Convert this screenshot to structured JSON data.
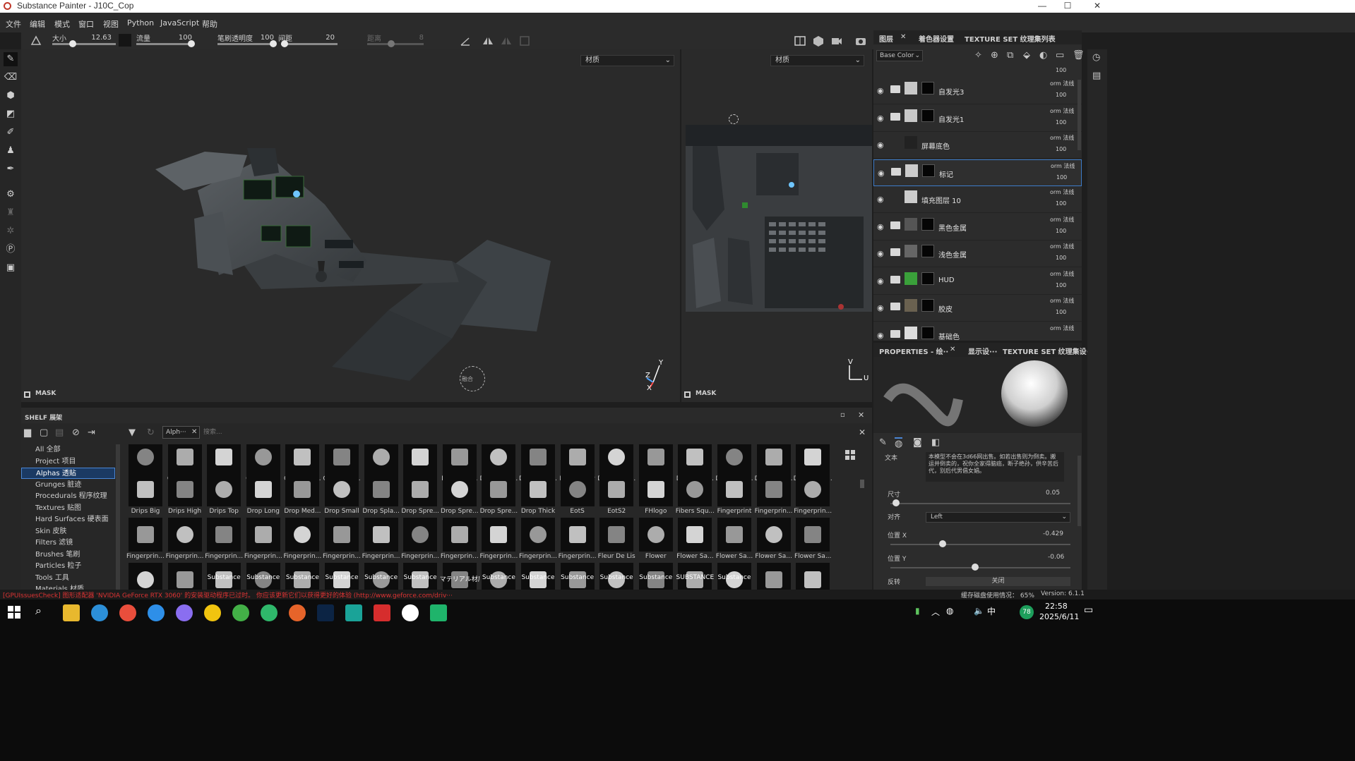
{
  "window": {
    "title": "Substance Painter - J10C_Cop",
    "min": "—",
    "max": "☐",
    "close": "✕"
  },
  "menu": [
    "文件",
    "编辑",
    "模式",
    "窗口",
    "视图",
    "Python",
    "JavaScript",
    "帮助"
  ],
  "tool_options": {
    "size_label": "大小",
    "size_value": "12.63",
    "flow_label": "流量",
    "flow_value": "100",
    "opacity_label": "笔刷透明度",
    "opacity_value": "100",
    "spacing_label": "间距",
    "spacing_value": "20",
    "angle_label": "距离",
    "angle_value": "8"
  },
  "viewport3d": {
    "material_select": "材质",
    "mask_label": "MASK",
    "axis_y": "Y",
    "axis_z": "Z",
    "axis_x": "X",
    "cursor_hint": "融合"
  },
  "viewport2d": {
    "material_select": "材质",
    "mask_label": "MASK",
    "axis_v": "V",
    "axis_u": "U"
  },
  "shelf": {
    "title": "SHELF 展架",
    "filter_chip": "Alph···",
    "search_placeholder": "搜索...",
    "categories": [
      {
        "label": "All 全部"
      },
      {
        "label": "Project 项目"
      },
      {
        "label": "Alphas 透贴"
      },
      {
        "label": "Grunges 脏迹"
      },
      {
        "label": "Procedurals 程序纹理"
      },
      {
        "label": "Textures 贴图"
      },
      {
        "label": "Hard Surfaces 硬表面"
      },
      {
        "label": "Skin 皮肤"
      },
      {
        "label": "Filters 滤镜"
      },
      {
        "label": "Brushes 笔刷"
      },
      {
        "label": "Particles 粒子"
      },
      {
        "label": "Tools 工具"
      },
      {
        "label": "Materials 材质"
      }
    ],
    "row1": [
      "Cross Half",
      "Cross Me...",
      "Cross Me...",
      "Cross Me...",
      "Cross Rec...",
      "Cross Rou...",
      "Cross Split",
      "Cross Thin",
      "Diagonal ...",
      "Dirt Blurry...",
      "Dirt Brush...",
      "Dirt Cloudy",
      "Dirt Smud...",
      "Dirt Spots",
      "Dirt Spots...",
      "Dirt Spots...",
      "Dirt Stain ...",
      "Dots Circu..."
    ],
    "row2": [
      "Drips Big",
      "Drips High",
      "Drips Top",
      "Drop Long",
      "Drop Med...",
      "Drop Small",
      "Drop Spla...",
      "Drop Spre...",
      "Drop Spre...",
      "Drop Spre...",
      "Drop Thick",
      "EotS",
      "EotS2",
      "FHlogo",
      "Fibers Squ...",
      "Fingerprint",
      "Fingerprin...",
      "Fingerprin..."
    ],
    "row3": [
      "Fingerprin...",
      "Fingerprin...",
      "Fingerprin...",
      "Fingerprin...",
      "Fingerprin...",
      "Fingerprin...",
      "Fingerprin...",
      "Fingerprin...",
      "Fingerprin...",
      "Fingerprin...",
      "Fingerprin...",
      "Fingerprin...",
      "Fleur De Lis",
      "Flower",
      "Flower Sa...",
      "Flower Sa...",
      "Flower Sa...",
      "Flower Sa..."
    ],
    "row4": [
      "",
      "",
      "Substance",
      "Substance",
      "Substance",
      "Substance",
      "Substance",
      "Substance",
      "マテリアル材质",
      "Substance",
      "Substance",
      "Substance",
      "Substance",
      "Substance",
      "SUBSTANCE",
      "Substance",
      "",
      "",
      ""
    ]
  },
  "layers_panel": {
    "tabs": [
      "图层",
      "着色器设置",
      "TEXTURE SET 纹理集列表"
    ],
    "channel_select": "Base Color",
    "top_opacity": "100",
    "layers": [
      {
        "name": "自发光3",
        "blend": "orm 法线",
        "opacity": "100"
      },
      {
        "name": "自发光1",
        "blend": "orm 法线",
        "opacity": "100"
      },
      {
        "name": "屏幕底色",
        "blend": "orm 法线",
        "opacity": "100"
      },
      {
        "name": "标记",
        "blend": "orm 法线",
        "opacity": "100"
      },
      {
        "name": "填充图层 10",
        "blend": "orm 法线",
        "opacity": "100"
      },
      {
        "name": "黑色金属",
        "blend": "orm 法线",
        "opacity": "100"
      },
      {
        "name": "浅色金属",
        "blend": "orm 法线",
        "opacity": "100"
      },
      {
        "name": "HUD",
        "blend": "orm 法线",
        "opacity": "100"
      },
      {
        "name": "胶皮",
        "blend": "orm 法线",
        "opacity": "100"
      },
      {
        "name": "基础色",
        "blend": "orm 法线",
        "opacity": ""
      }
    ]
  },
  "properties_panel": {
    "tabs": [
      "PROPERTIES - 绘··",
      "显示设···",
      "TEXTURE SET 纹理集设···"
    ],
    "text_label": "文本",
    "text_value": "本模型不会在3d66网出售。如若出售则为倒卖。搬运并倒卖的，祝你全家得脑癌，断子绝孙，供辛苦后代，别后代男倡女娼。",
    "size_label": "尺寸",
    "size_value": "0.05",
    "size_pct": 0.03,
    "align_label": "对齐",
    "align_value": "Left",
    "posx_label": "位置 X",
    "posx_value": "-0.429",
    "posx_pct": 0.29,
    "posy_label": "位置 Y",
    "posy_value": "-0.06",
    "posy_pct": 0.47,
    "invert_label": "反转",
    "invert_value": "关闭"
  },
  "statusbar": {
    "warning": "[GPUIssuesCheck] 图形适配器 'NVIDIA GeForce RTX 3060' 的安装驱动程序已过时。 你应该更新它们以获得更好的体验 (http://www.geforce.com/driv···",
    "cache": "缓存磁盘使用情况： 65%",
    "version": "Version: 6.1.1"
  },
  "taskbar": {
    "time": "22:58",
    "date": "2025/6/11",
    "ime": "中",
    "badge": "78"
  }
}
